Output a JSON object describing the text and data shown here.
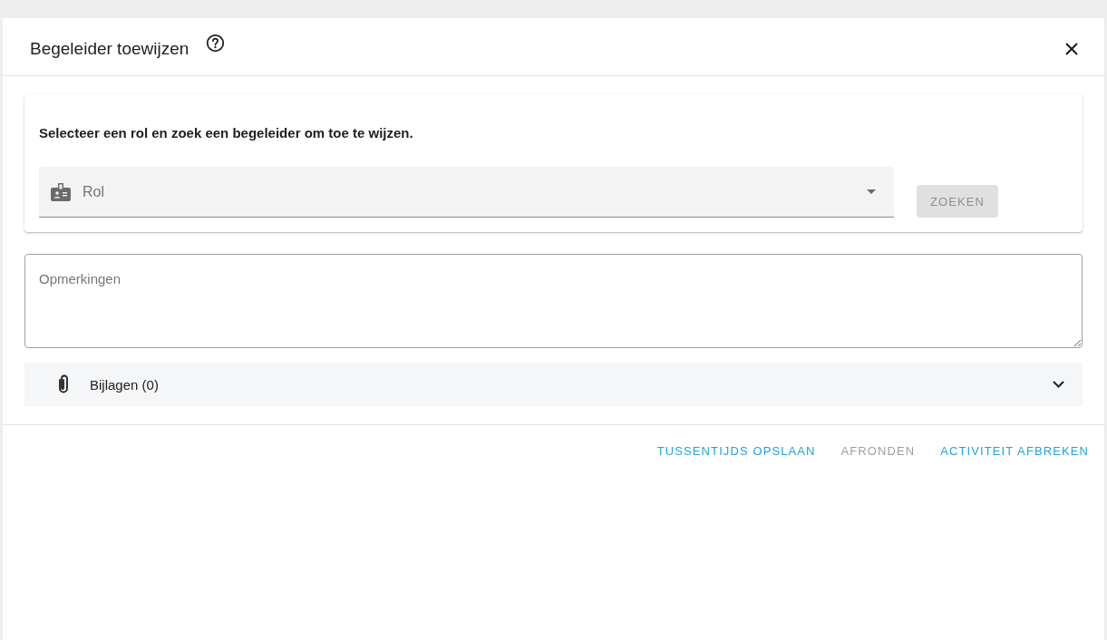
{
  "dialog": {
    "title": "Begeleider toewijzen"
  },
  "search_card": {
    "instruction": "Selecteer een rol en zoek een begeleider om toe te wijzen.",
    "role_field": {
      "placeholder": "Rol"
    },
    "search_button": {
      "label": "ZOEKEN",
      "disabled": true
    }
  },
  "remarks": {
    "placeholder": "Opmerkingen"
  },
  "attachments": {
    "label": "Bijlagen (0)",
    "expanded": false
  },
  "actions": [
    {
      "label": "TUSSENTIJDS OPSLAAN",
      "disabled": false
    },
    {
      "label": "AFRONDEN",
      "disabled": true
    },
    {
      "label": "ACTIVITEIT AFBREKEN",
      "disabled": false
    }
  ]
}
